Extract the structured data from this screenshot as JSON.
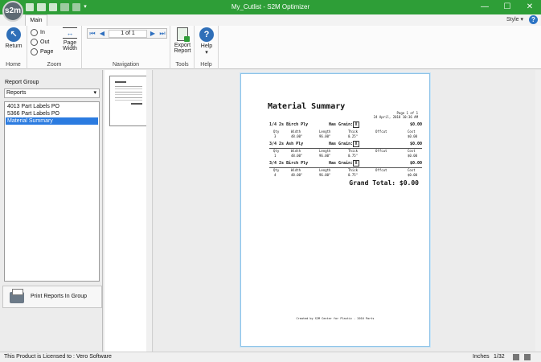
{
  "window": {
    "title": "My_Cutlist - S2M Optimizer",
    "logo": "s2m",
    "minimize": "—",
    "maximize": "☐",
    "close": "✕"
  },
  "tabs": [
    {
      "label": "Main"
    }
  ],
  "style_label": "Style",
  "ribbon": {
    "home": {
      "group": "Home",
      "return": "Return"
    },
    "zoom": {
      "group": "Zoom",
      "in": "In",
      "out": "Out",
      "page": "Page",
      "page_width_1": "Page",
      "page_width_2": "Width"
    },
    "navigation": {
      "group": "Navigation",
      "page_indicator": "1 of 1"
    },
    "tools": {
      "group": "Tools",
      "export_1": "Export",
      "export_2": "Report"
    },
    "help": {
      "group": "Help",
      "help": "Help"
    }
  },
  "left_panel": {
    "report_group_label": "Report Group",
    "report_group_value": "Reports",
    "reports": [
      {
        "label": "4013 Part Labels PO",
        "selected": false
      },
      {
        "label": "5366 Part Labels PO",
        "selected": false
      },
      {
        "label": "Material Summary",
        "selected": true
      }
    ],
    "print_button": "Print Reports In Group"
  },
  "report": {
    "title": "Material Summary",
    "page_info": "Page 1 of 1",
    "date": "24 April, 2018 10:36 AM",
    "columns": {
      "qty": "Qty",
      "width": "Width",
      "length": "Length",
      "thick": "Thick",
      "offcut": "Offcut",
      "cost": "Cost"
    },
    "grain_label": "Has Grain:",
    "grain_mark": "X",
    "materials": [
      {
        "name": "1/4 2s Birch Ply",
        "amount": "$0.00",
        "qty": "3",
        "width": "48.00\"",
        "length": "96.00\"",
        "thick": "0.25\"",
        "cost": "$0.00"
      },
      {
        "name": "3/4 2s Ash Ply",
        "amount": "$0.00",
        "qty": "1",
        "width": "48.00\"",
        "length": "96.00\"",
        "thick": "0.75\"",
        "cost": "$0.00"
      },
      {
        "name": "3/4 2s Birch Ply",
        "amount": "$0.00",
        "qty": "4",
        "width": "48.00\"",
        "length": "96.00\"",
        "thick": "0.75\"",
        "cost": "$0.00"
      }
    ],
    "grand_total": "Grand Total: $0.00",
    "footer": "Created by S2M Center for Plastic - 2016 Parts"
  },
  "status": {
    "license": "This Product is Licensed to : Vero Software",
    "units": "Inches",
    "precision": "1/32"
  },
  "colors": {
    "title_bar": "#2e9e37",
    "selection": "#2b7be0",
    "accent_blue": "#2f6fb8"
  }
}
